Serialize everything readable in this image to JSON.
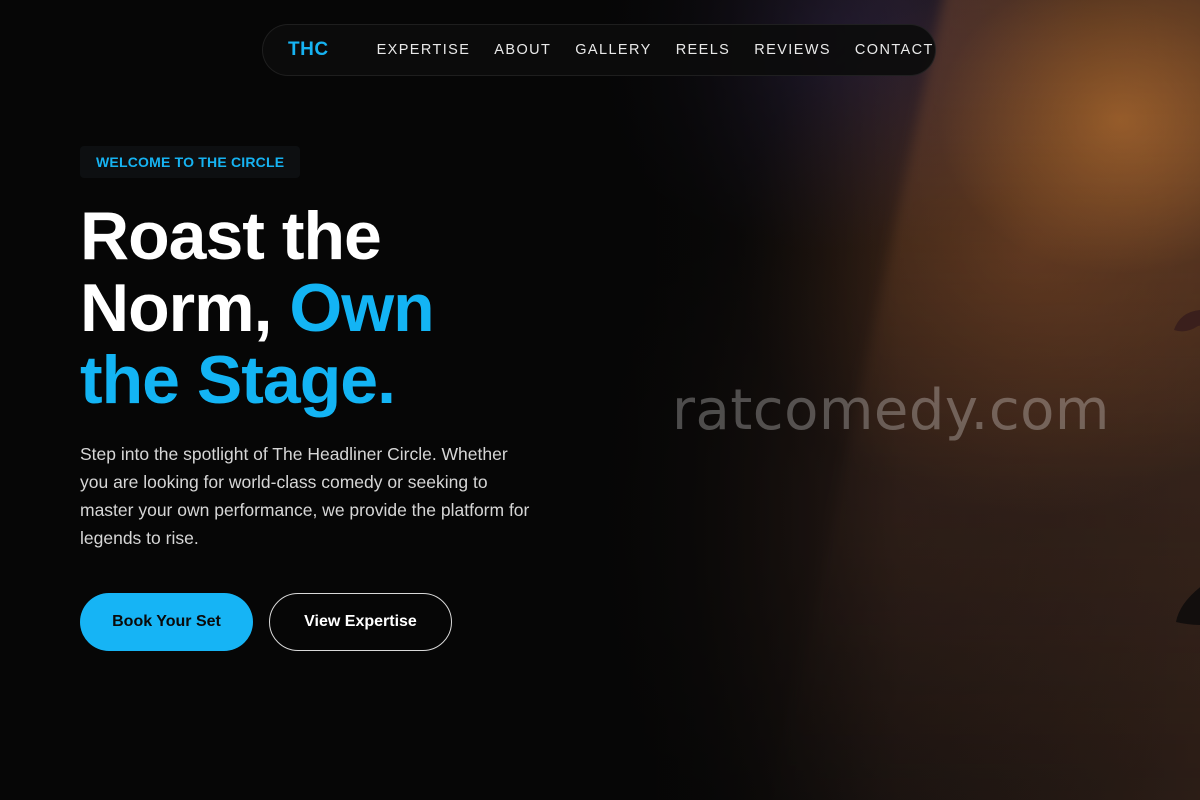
{
  "nav": {
    "logo": "THC",
    "links": [
      "EXPERTISE",
      "ABOUT",
      "GALLERY",
      "REELS",
      "REVIEWS",
      "CONTACT"
    ]
  },
  "hero": {
    "badge": "WELCOME TO THE CIRCLE",
    "headline": {
      "part1": "Roast the Norm, ",
      "accent": "Own the Stage."
    },
    "description": "Step into the spotlight of The Headliner Circle. Whether you are looking for world-class comedy or seeking to master your own performance, we provide the platform for legends to rise.",
    "primary_button": "Book Your Set",
    "secondary_button": "View Expertise"
  },
  "watermark": "ratcomedy.com",
  "colors": {
    "accent": "#16b3f2",
    "background": "#060606",
    "text": "#ffffff"
  },
  "icons": {
    "stage_image": "stage-performer-photo"
  }
}
